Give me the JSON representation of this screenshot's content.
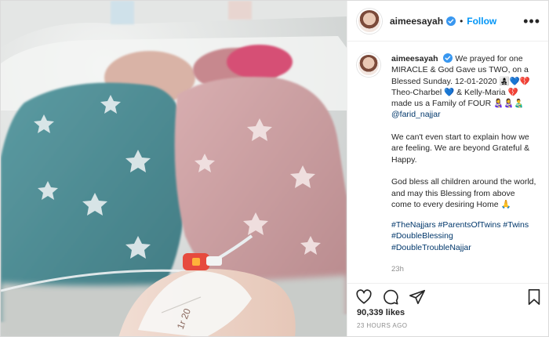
{
  "header": {
    "username": "aimeesayah",
    "separator": "•",
    "follow_label": "Follow",
    "more_label": "•••"
  },
  "caption": {
    "username": "aimeesayah",
    "line1": "We prayed for one MIRACLE & God Gave us TWO, on a Blessed Sunday. 12-01-2020 👩‍👧‍👦💙💔",
    "line2": "Theo-Charbel 💙 & Kelly-Maria 💔 made us a Family of FOUR 👩‍🍼👩‍🍼👨‍🍼",
    "mention": "@farid_najjar",
    "para2": "We can't even start to explain how we are feeling. We are beyond Grateful & Happy.",
    "para3": "God bless all children around the world, and may this Blessing from above come to every desiring Home 🙏",
    "hashtags": [
      "#TheNajjars",
      "#ParentsOfTwins",
      "#Twins",
      "#DoubleBlessing",
      "#DoubleTroubleNajjar"
    ],
    "time": "23h"
  },
  "stats": {
    "likes": "90,339 likes",
    "posted": "23 HOURS AGO"
  },
  "colors": {
    "link_blue": "#0095f6",
    "hashtag_blue": "#00376b",
    "blanket_blue": "#4f8e96",
    "blanket_pink": "#c79a9c"
  },
  "icons": [
    "verified-badge-icon",
    "heart-icon",
    "comment-icon",
    "share-icon",
    "bookmark-icon",
    "more-icon"
  ]
}
